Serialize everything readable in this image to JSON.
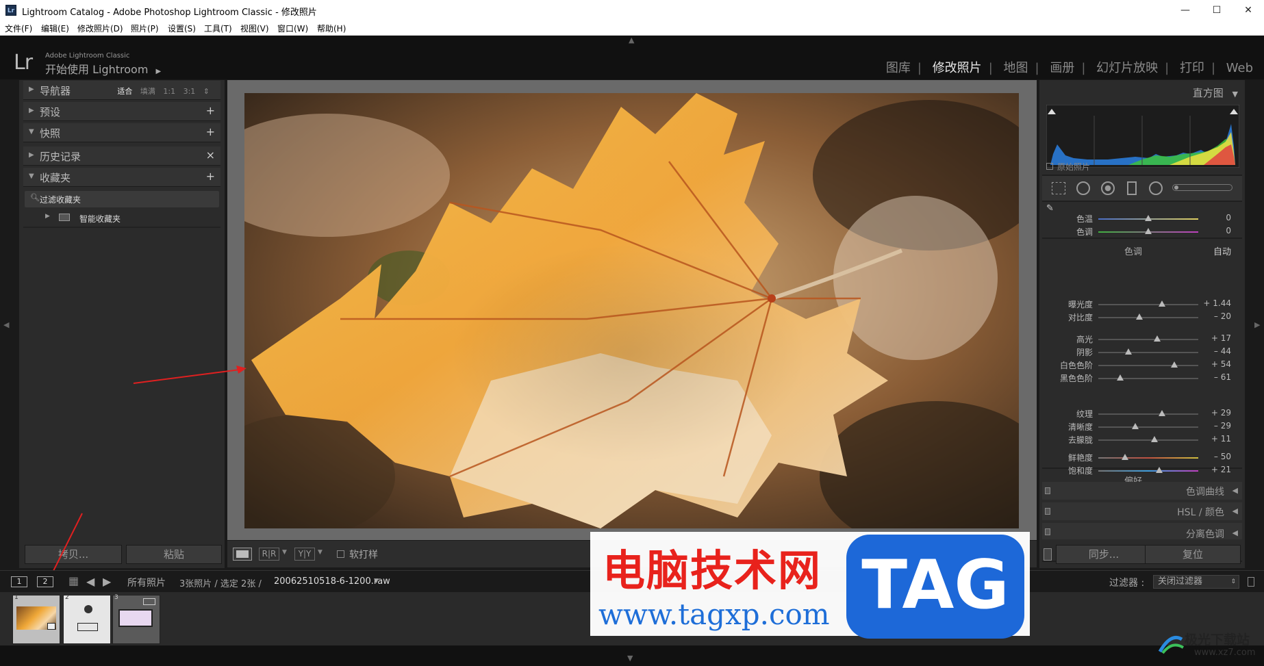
{
  "window": {
    "title": "Lightroom Catalog - Adobe Photoshop Lightroom Classic - 修改照片",
    "app_icon": "Lr",
    "minimize": "—",
    "maximize": "☐",
    "close": "✕"
  },
  "menu": [
    "文件(F)",
    "编辑(E)",
    "修改照片(D)",
    "照片(P)",
    "设置(S)",
    "工具(T)",
    "视图(V)",
    "窗口(W)",
    "帮助(H)"
  ],
  "identity": {
    "logo": "Lr",
    "product": "Adobe Lightroom Classic",
    "start": "开始使用 Lightroom",
    "start_arrow": "▶"
  },
  "modules": [
    "图库",
    "修改照片",
    "地图",
    "画册",
    "幻灯片放映",
    "打印",
    "Web"
  ],
  "active_module": "修改照片",
  "left_panel": {
    "navigator": {
      "label": "导航器",
      "options": [
        "适合",
        "填满",
        "1:1",
        "3:1"
      ],
      "selected": "适合"
    },
    "presets": {
      "label": "预设",
      "action": "+"
    },
    "snapshots": {
      "label": "快照",
      "action": "+"
    },
    "history": {
      "label": "历史记录",
      "action": "×"
    },
    "collections": {
      "label": "收藏夹",
      "action": "+"
    },
    "filter_collections": "过滤收藏夹",
    "smart_collections": "智能收藏夹",
    "copy_button": "拷贝...",
    "paste_button": "粘贴"
  },
  "toolbar": {
    "soft_proof": "软打样",
    "view_before_after_1": "R|R",
    "view_before_after_2": "Y|Y"
  },
  "right_panel": {
    "histogram_label": "直方图",
    "original_photo": "原始照片",
    "basic_rows_top": [
      {
        "label": "色温",
        "value": "0",
        "pos": 0.5
      },
      {
        "label": "色调",
        "value": "0",
        "pos": 0.5
      }
    ],
    "tone_label": "色调",
    "auto_label": "自动",
    "tone_rows": [
      {
        "label": "曝光度",
        "value": "+ 1.44",
        "pos": 0.64
      },
      {
        "label": "对比度",
        "value": "– 20",
        "pos": 0.41
      },
      {
        "label": "高光",
        "value": "+ 17",
        "pos": 0.59
      },
      {
        "label": "阴影",
        "value": "– 44",
        "pos": 0.3
      },
      {
        "label": "白色色阶",
        "value": "+ 54",
        "pos": 0.76
      },
      {
        "label": "黑色色阶",
        "value": "– 61",
        "pos": 0.22
      }
    ],
    "presence_label": "偏好",
    "presence_rows": [
      {
        "label": "纹理",
        "value": "+ 29",
        "pos": 0.64
      },
      {
        "label": "清晰度",
        "value": "– 29",
        "pos": 0.37
      },
      {
        "label": "去朦胧",
        "value": "+ 11",
        "pos": 0.56
      },
      {
        "label": "鲜艳度",
        "value": "– 50",
        "pos": 0.27
      },
      {
        "label": "饱和度",
        "value": "+ 21",
        "pos": 0.61
      }
    ],
    "tone_curve": "色调曲线",
    "hsl": "HSL / 颜色",
    "split_toning": "分离色调",
    "sync_button": "同步...",
    "reset_button": "复位"
  },
  "filmstrip": {
    "page_1": "1",
    "page_2": "2",
    "source": "所有照片",
    "info": "3张照片 / 选定 2张 /",
    "filename": "20062510518-6-1200.raw",
    "filter_label": "过滤器 :",
    "filter_value": "关闭过滤器",
    "thumbs": [
      "1",
      "2",
      "3"
    ]
  },
  "watermark": {
    "cn_text": "电脑技术网",
    "url": "www.tagxp.com",
    "tag": "TAG",
    "site2": "极光下载站",
    "site2_url": "www.xz7.com"
  },
  "colors": {
    "accent_red_arrow": "#e02020",
    "watermark_red": "#e8221c",
    "watermark_blue": "#1d68d8"
  }
}
